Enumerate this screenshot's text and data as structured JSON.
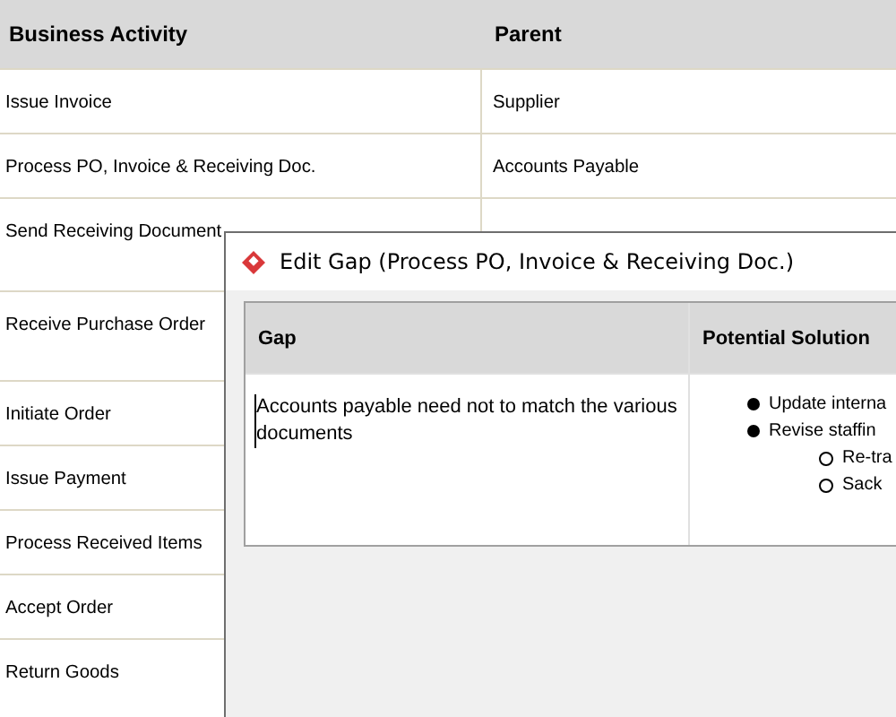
{
  "table": {
    "columns": [
      "Business Activity",
      "Parent"
    ],
    "rows": [
      [
        "Issue Invoice",
        "Supplier"
      ],
      [
        "Process PO, Invoice & Receiving Doc.",
        "Accounts Payable"
      ],
      [
        "Send Receiving Document"
      ],
      [
        "Receive Purchase Order"
      ],
      [
        "Initiate Order"
      ],
      [
        "Issue Payment"
      ],
      [
        "Process Received Items"
      ],
      [
        "Accept Order"
      ],
      [
        "Return Goods"
      ]
    ]
  },
  "dialog": {
    "title": "Edit Gap (Process PO, Invoice & Receiving Doc.)",
    "columns": [
      "Gap",
      "Potential Solution"
    ],
    "gap": "Accounts payable need not to match the various documents",
    "solutions": [
      {
        "text": "Update interna",
        "kind": "filled"
      },
      {
        "text": "Revise staffin",
        "kind": "filled",
        "children": [
          {
            "text": "Re-tra",
            "kind": "open"
          },
          {
            "text": "Sack",
            "kind": "open"
          }
        ]
      }
    ]
  }
}
